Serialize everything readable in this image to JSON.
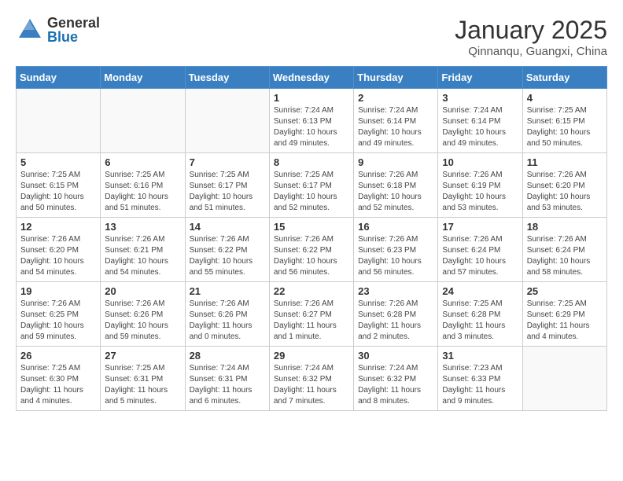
{
  "header": {
    "logo_general": "General",
    "logo_blue": "Blue",
    "month": "January 2025",
    "location": "Qinnanqu, Guangxi, China"
  },
  "weekdays": [
    "Sunday",
    "Monday",
    "Tuesday",
    "Wednesday",
    "Thursday",
    "Friday",
    "Saturday"
  ],
  "weeks": [
    [
      {
        "day": "",
        "info": ""
      },
      {
        "day": "",
        "info": ""
      },
      {
        "day": "",
        "info": ""
      },
      {
        "day": "1",
        "info": "Sunrise: 7:24 AM\nSunset: 6:13 PM\nDaylight: 10 hours\nand 49 minutes."
      },
      {
        "day": "2",
        "info": "Sunrise: 7:24 AM\nSunset: 6:14 PM\nDaylight: 10 hours\nand 49 minutes."
      },
      {
        "day": "3",
        "info": "Sunrise: 7:24 AM\nSunset: 6:14 PM\nDaylight: 10 hours\nand 49 minutes."
      },
      {
        "day": "4",
        "info": "Sunrise: 7:25 AM\nSunset: 6:15 PM\nDaylight: 10 hours\nand 50 minutes."
      }
    ],
    [
      {
        "day": "5",
        "info": "Sunrise: 7:25 AM\nSunset: 6:15 PM\nDaylight: 10 hours\nand 50 minutes."
      },
      {
        "day": "6",
        "info": "Sunrise: 7:25 AM\nSunset: 6:16 PM\nDaylight: 10 hours\nand 51 minutes."
      },
      {
        "day": "7",
        "info": "Sunrise: 7:25 AM\nSunset: 6:17 PM\nDaylight: 10 hours\nand 51 minutes."
      },
      {
        "day": "8",
        "info": "Sunrise: 7:25 AM\nSunset: 6:17 PM\nDaylight: 10 hours\nand 52 minutes."
      },
      {
        "day": "9",
        "info": "Sunrise: 7:26 AM\nSunset: 6:18 PM\nDaylight: 10 hours\nand 52 minutes."
      },
      {
        "day": "10",
        "info": "Sunrise: 7:26 AM\nSunset: 6:19 PM\nDaylight: 10 hours\nand 53 minutes."
      },
      {
        "day": "11",
        "info": "Sunrise: 7:26 AM\nSunset: 6:20 PM\nDaylight: 10 hours\nand 53 minutes."
      }
    ],
    [
      {
        "day": "12",
        "info": "Sunrise: 7:26 AM\nSunset: 6:20 PM\nDaylight: 10 hours\nand 54 minutes."
      },
      {
        "day": "13",
        "info": "Sunrise: 7:26 AM\nSunset: 6:21 PM\nDaylight: 10 hours\nand 54 minutes."
      },
      {
        "day": "14",
        "info": "Sunrise: 7:26 AM\nSunset: 6:22 PM\nDaylight: 10 hours\nand 55 minutes."
      },
      {
        "day": "15",
        "info": "Sunrise: 7:26 AM\nSunset: 6:22 PM\nDaylight: 10 hours\nand 56 minutes."
      },
      {
        "day": "16",
        "info": "Sunrise: 7:26 AM\nSunset: 6:23 PM\nDaylight: 10 hours\nand 56 minutes."
      },
      {
        "day": "17",
        "info": "Sunrise: 7:26 AM\nSunset: 6:24 PM\nDaylight: 10 hours\nand 57 minutes."
      },
      {
        "day": "18",
        "info": "Sunrise: 7:26 AM\nSunset: 6:24 PM\nDaylight: 10 hours\nand 58 minutes."
      }
    ],
    [
      {
        "day": "19",
        "info": "Sunrise: 7:26 AM\nSunset: 6:25 PM\nDaylight: 10 hours\nand 59 minutes."
      },
      {
        "day": "20",
        "info": "Sunrise: 7:26 AM\nSunset: 6:26 PM\nDaylight: 10 hours\nand 59 minutes."
      },
      {
        "day": "21",
        "info": "Sunrise: 7:26 AM\nSunset: 6:26 PM\nDaylight: 11 hours\nand 0 minutes."
      },
      {
        "day": "22",
        "info": "Sunrise: 7:26 AM\nSunset: 6:27 PM\nDaylight: 11 hours\nand 1 minute."
      },
      {
        "day": "23",
        "info": "Sunrise: 7:26 AM\nSunset: 6:28 PM\nDaylight: 11 hours\nand 2 minutes."
      },
      {
        "day": "24",
        "info": "Sunrise: 7:25 AM\nSunset: 6:28 PM\nDaylight: 11 hours\nand 3 minutes."
      },
      {
        "day": "25",
        "info": "Sunrise: 7:25 AM\nSunset: 6:29 PM\nDaylight: 11 hours\nand 4 minutes."
      }
    ],
    [
      {
        "day": "26",
        "info": "Sunrise: 7:25 AM\nSunset: 6:30 PM\nDaylight: 11 hours\nand 4 minutes."
      },
      {
        "day": "27",
        "info": "Sunrise: 7:25 AM\nSunset: 6:31 PM\nDaylight: 11 hours\nand 5 minutes."
      },
      {
        "day": "28",
        "info": "Sunrise: 7:24 AM\nSunset: 6:31 PM\nDaylight: 11 hours\nand 6 minutes."
      },
      {
        "day": "29",
        "info": "Sunrise: 7:24 AM\nSunset: 6:32 PM\nDaylight: 11 hours\nand 7 minutes."
      },
      {
        "day": "30",
        "info": "Sunrise: 7:24 AM\nSunset: 6:32 PM\nDaylight: 11 hours\nand 8 minutes."
      },
      {
        "day": "31",
        "info": "Sunrise: 7:23 AM\nSunset: 6:33 PM\nDaylight: 11 hours\nand 9 minutes."
      },
      {
        "day": "",
        "info": ""
      }
    ]
  ]
}
